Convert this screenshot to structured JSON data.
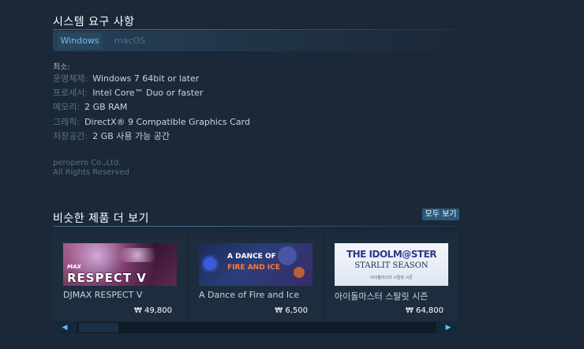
{
  "sysreq": {
    "title": "시스템 요구 사항",
    "tabs": [
      {
        "label": "Windows",
        "active": true
      },
      {
        "label": "macOS",
        "active": false
      }
    ],
    "minimum_label": "최소:",
    "rows": [
      {
        "key": "운영체제:",
        "value": "Windows 7 64bit or later"
      },
      {
        "key": "프로세서:",
        "value": "Intel Core™ Duo or faster"
      },
      {
        "key": "메모리:",
        "value": "2 GB RAM"
      },
      {
        "key": "그래픽:",
        "value": "DirectX® 9 Compatible Graphics Card"
      },
      {
        "key": "저장공간:",
        "value": "2 GB 사용 가능 공간"
      }
    ]
  },
  "legal": {
    "line1": "peropero Co.,Ltd.",
    "line2": "All Rights Reserved"
  },
  "similar": {
    "title": "비슷한 제품 더 보기",
    "see_all": "모두 보기",
    "items": [
      {
        "name": "DJMAX RESPECT V",
        "price": "₩ 49,800",
        "logo_text": "RESPECT V",
        "logo_small": "MAX"
      },
      {
        "name": "A Dance of Fire and Ice",
        "price": "₩ 6,500",
        "logo_text": "A DANCE OF",
        "logo_text2": "FIRE AND ICE"
      },
      {
        "name": "아이돌마스터 스탈릿 시즌",
        "price": "₩ 64,800",
        "logo_text": "THE IDOLM@STER",
        "logo_text2": "STARLIT SEASON",
        "logo_small": "아이돌마스터 스탈릿 시즌"
      }
    ]
  },
  "scroll": {
    "left_arrow": "◀",
    "right_arrow": "▶"
  },
  "colors": {
    "background": "#1b2838",
    "accent": "#66c0f4",
    "card": "#1e2d3d"
  }
}
